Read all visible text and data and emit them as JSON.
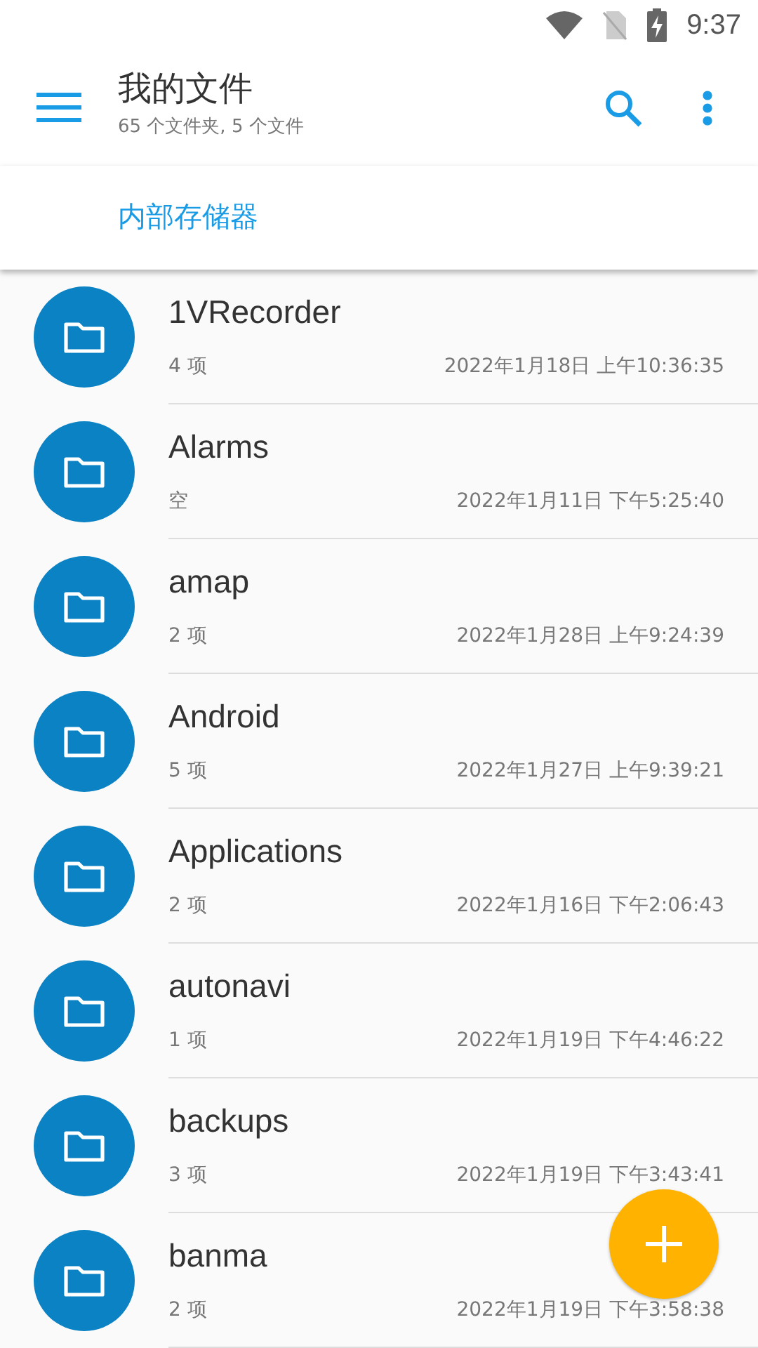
{
  "status_bar": {
    "time": "9:37"
  },
  "toolbar": {
    "title": "我的文件",
    "subtitle": "65 个文件夹, 5 个文件"
  },
  "tabs": [
    {
      "label": "内部存储器",
      "selected": true
    }
  ],
  "folders": [
    {
      "name": "1VRecorder",
      "count": "4 项",
      "modified": "2022年1月18日 上午10:36:35"
    },
    {
      "name": "Alarms",
      "count": "空",
      "modified": "2022年1月11日 下午5:25:40"
    },
    {
      "name": "amap",
      "count": "2 项",
      "modified": "2022年1月28日 上午9:24:39"
    },
    {
      "name": "Android",
      "count": "5 项",
      "modified": "2022年1月27日 上午9:39:21"
    },
    {
      "name": "Applications",
      "count": "2 项",
      "modified": "2022年1月16日 下午2:06:43"
    },
    {
      "name": "autonavi",
      "count": "1 项",
      "modified": "2022年1月19日 下午4:46:22"
    },
    {
      "name": "backups",
      "count": "3 项",
      "modified": "2022年1月19日 下午3:43:41"
    },
    {
      "name": "banma",
      "count": "2 项",
      "modified": "2022年1月19日 下午3:58:38"
    }
  ]
}
